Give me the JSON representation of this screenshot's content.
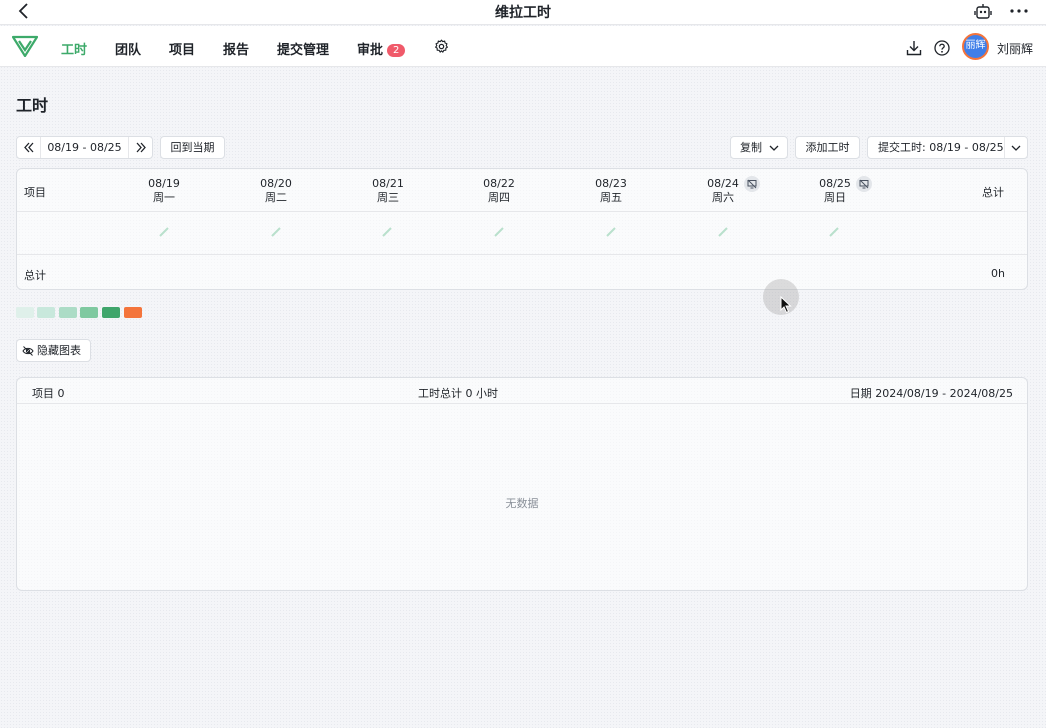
{
  "appbar": {
    "title": "维拉工时",
    "icons": [
      "back-arrow-icon",
      "robot-icon",
      "more-icon"
    ]
  },
  "nav": {
    "items": [
      {
        "label": "工时",
        "active": true
      },
      {
        "label": "团队"
      },
      {
        "label": "项目"
      },
      {
        "label": "报告"
      },
      {
        "label": "提交管理"
      },
      {
        "label": "审批",
        "badge": "2"
      }
    ],
    "user": {
      "name": "刘丽辉",
      "avatar_text": "丽辉"
    },
    "accent_color": "#3daa6a",
    "badge_color": "#f05a6a"
  },
  "page": {
    "title": "工时"
  },
  "toolbar": {
    "range": "08/19 - 08/25",
    "back_to_current": "回到当期",
    "copy": "复制",
    "add_hours": "添加工时",
    "submit": "提交工时: 08/19 - 08/25"
  },
  "grid": {
    "project_header": "项目",
    "total_header": "总计",
    "days": [
      {
        "date": "08/19",
        "weekday": "周一"
      },
      {
        "date": "08/20",
        "weekday": "周二"
      },
      {
        "date": "08/21",
        "weekday": "周三"
      },
      {
        "date": "08/22",
        "weekday": "周四"
      },
      {
        "date": "08/23",
        "weekday": "周五"
      },
      {
        "date": "08/24",
        "weekday": "周六",
        "hidden_toggle": true
      },
      {
        "date": "08/25",
        "weekday": "周日",
        "hidden_toggle": true
      }
    ],
    "footer_label": "总计",
    "footer_total": "0h"
  },
  "legend": {
    "colors": [
      "#dff0ea",
      "#c8e8dc",
      "#acdcc6",
      "#7fc9a0",
      "#3fa56b",
      "#f4743b"
    ]
  },
  "chart_toggle": {
    "label": "隐藏图表"
  },
  "list": {
    "projects": "项目 0",
    "total_hours": "工时总计 0 小时",
    "date_range": "日期 2024/08/19 - 2024/08/25",
    "empty": "无数据"
  }
}
